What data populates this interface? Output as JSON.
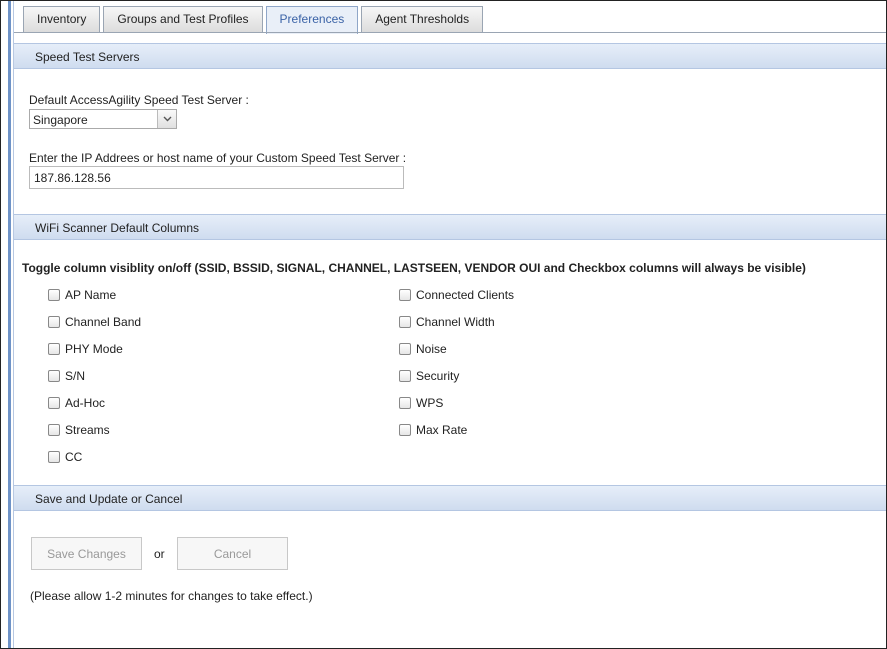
{
  "tabs": [
    {
      "label": "Inventory",
      "active": false
    },
    {
      "label": "Groups and Test Profiles",
      "active": false
    },
    {
      "label": "Preferences",
      "active": true
    },
    {
      "label": "Agent Thresholds",
      "active": false
    }
  ],
  "speed_test": {
    "header": "Speed Test Servers",
    "default_server_label": "Default AccessAgility Speed Test Server :",
    "default_server_value": "Singapore",
    "custom_server_label": "Enter the IP Addrees or host name of your Custom Speed Test Server :",
    "custom_server_value": "187.86.128.56"
  },
  "wifi_columns": {
    "header": "WiFi Scanner Default Columns",
    "toggle_title": "Toggle column visiblity on/off (SSID, BSSID, SIGNAL, CHANNEL, LASTSEEN, VENDOR OUI and Checkbox columns will always be visible)",
    "left_column": [
      {
        "label": "AP Name",
        "checked": false
      },
      {
        "label": "Channel Band",
        "checked": false
      },
      {
        "label": "PHY Mode",
        "checked": false
      },
      {
        "label": "S/N",
        "checked": false
      },
      {
        "label": "Ad-Hoc",
        "checked": false
      },
      {
        "label": "Streams",
        "checked": false
      },
      {
        "label": "CC",
        "checked": false
      }
    ],
    "right_column": [
      {
        "label": "Connected Clients",
        "checked": false
      },
      {
        "label": "Channel Width",
        "checked": false
      },
      {
        "label": "Noise",
        "checked": false
      },
      {
        "label": "Security",
        "checked": false
      },
      {
        "label": "WPS",
        "checked": false
      },
      {
        "label": "Max Rate",
        "checked": false
      }
    ]
  },
  "save_section": {
    "header": "Save and Update or Cancel",
    "save_label": "Save Changes",
    "or_text": "or",
    "cancel_label": "Cancel",
    "note": "(Please allow 1-2 minutes for changes to take effect.)"
  }
}
